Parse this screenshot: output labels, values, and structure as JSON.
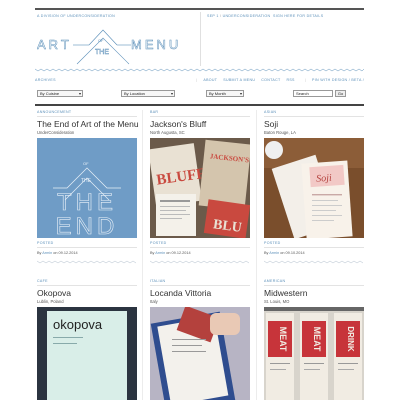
{
  "header": {
    "tagline": "A Division of UnderConsideration",
    "issue_label": "Sep 1",
    "issue_sep": "/",
    "issue_rest": "UnderConsideration",
    "issue_link": "Sign here for details",
    "logo_left": "ART",
    "logo_of": "OF",
    "logo_the": "THE",
    "logo_right": "MENU"
  },
  "nav": {
    "left_label": "Archives",
    "items": [
      "About",
      "Submit a menu",
      "Contact",
      "RSS"
    ],
    "right_label": "Pin with Design / Beta / Not so cool"
  },
  "filters": {
    "cuisine": "By Cuisine",
    "location": "By Location",
    "month": "By Month",
    "search_value": "Search",
    "go_label": "Go"
  },
  "posts": [
    {
      "category": "Announcement",
      "title": "The End of Art of the Menu",
      "location": "UnderConsideration",
      "posted_label": "Posted",
      "by": "By",
      "author": "Armin",
      "date": "on 09.12.2014",
      "cover": {
        "of": "OF",
        "the": "THE",
        "word1": "THE",
        "word2": "END"
      }
    },
    {
      "category": "Bar",
      "title": "Jackson's Bluff",
      "location": "North Augusta, SC",
      "posted_label": "Posted",
      "by": "By",
      "author": "Armin",
      "date": "on 09.12.2014",
      "cover": {
        "word1": "JACKSON'S",
        "word2": "BLUFF",
        "word3": "BLU"
      }
    },
    {
      "category": "Asian",
      "title": "Soji",
      "location": "Baton Rouge, LA",
      "posted_label": "Posted",
      "by": "By",
      "author": "Armin",
      "date": "on 09.10.2014",
      "cover": {
        "word1": "Soji"
      }
    },
    {
      "category": "Cafe",
      "title": "Okopova",
      "location": "Lublin, Poland",
      "posted_label": "",
      "by": "",
      "author": "",
      "date": "",
      "cover": {
        "word1": "okopova"
      }
    },
    {
      "category": "Italian",
      "title": "Locanda Vittoria",
      "location": "Italy",
      "posted_label": "",
      "by": "",
      "author": "",
      "date": "",
      "cover": {
        "word1": "Locanda Vittoria"
      }
    },
    {
      "category": "American",
      "title": "Midwestern",
      "location": "St. Louis, MO",
      "posted_label": "",
      "by": "",
      "author": "",
      "date": "",
      "cover": {
        "word1": "MEAT",
        "word2": "DRINK"
      }
    }
  ],
  "colors": {
    "accent": "#5b8fb9",
    "rule": "#444444"
  }
}
